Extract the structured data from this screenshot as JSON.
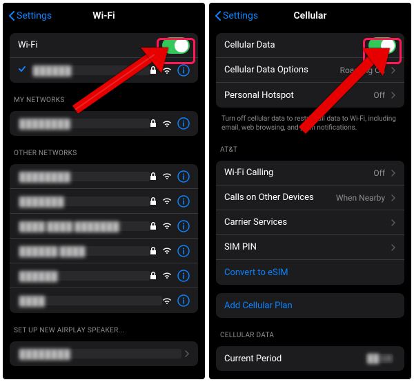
{
  "wifi": {
    "back": "Settings",
    "title": "Wi-Fi",
    "main_label": "Wi-Fi",
    "connected": "██████",
    "section_my": "MY NETWORKS",
    "my1": "████████",
    "section_other": "OTHER NETWORKS",
    "o1": "████████",
    "o2": "███████",
    "o3": "████ ████ ███████",
    "o4": "██████ ████",
    "o5": "██████",
    "o6": "████",
    "section_airplay": "SET UP NEW AIRPLAY SPEAKER...",
    "air1": "████████"
  },
  "cellular": {
    "back": "Settings",
    "title": "Cellular",
    "data_label": "Cellular Data",
    "options_label": "Cellular Data Options",
    "options_value": "Roaming On",
    "hotspot_label": "Personal Hotspot",
    "hotspot_value": "Off",
    "footer": "Turn off cellular data to restrict all data to Wi-Fi, including email, web browsing, and push notifications.",
    "carrier_header": "AT&T",
    "wificalling_label": "Wi-Fi Calling",
    "wificalling_value": "Off",
    "calls_label": "Calls on Other Devices",
    "calls_value": "When Nearby",
    "carrier_services": "Carrier Services",
    "sim_pin": "SIM PIN",
    "convert": "Convert to eSIM",
    "add_plan": "Add Cellular Plan",
    "section_data": "CELLULAR DATA",
    "period_label": "Current Period",
    "period_value": "██ GB"
  }
}
